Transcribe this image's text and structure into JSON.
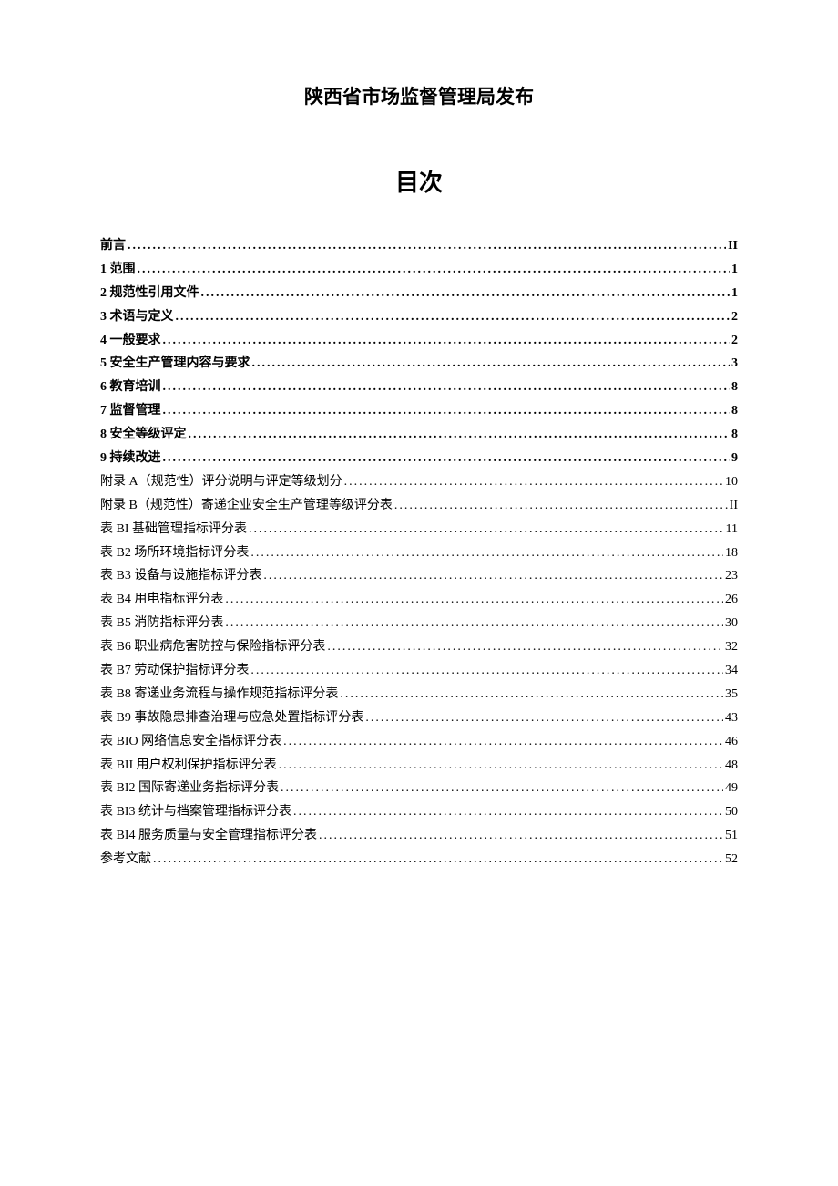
{
  "header": "陕西省市场监督管理局发布",
  "toc_title": "目次",
  "toc": [
    {
      "label": "前言",
      "page": "II",
      "bold": true
    },
    {
      "label": "1 范围",
      "page": "1",
      "bold": true
    },
    {
      "label": "2 规范性引用文件",
      "page": "1",
      "bold": true
    },
    {
      "label": "3 术语与定义",
      "page": "2",
      "bold": true
    },
    {
      "label": "4 一般要求",
      "page": "2",
      "bold": true
    },
    {
      "label": "5 安全生产管理内容与要求",
      "page": "3",
      "bold": true
    },
    {
      "label": "6 教育培训",
      "page": "8",
      "bold": true
    },
    {
      "label": "7 监督管理",
      "page": "8",
      "bold": true
    },
    {
      "label": "8 安全等级评定",
      "page": "8",
      "bold": true
    },
    {
      "label": "9 持续改进",
      "page": "9",
      "bold": true
    },
    {
      "label": "附录 A（规范性）评分说明与评定等级划分",
      "page": "10",
      "bold": false
    },
    {
      "label": "附录 B（规范性）寄递企业安全生产管理等级评分表",
      "page": "II",
      "bold": false
    },
    {
      "label": "表 BI 基础管理指标评分表",
      "page": "11",
      "bold": false
    },
    {
      "label": "表 B2 场所环境指标评分表",
      "page": "18",
      "bold": false
    },
    {
      "label": "表 B3 设备与设施指标评分表",
      "page": "23",
      "bold": false
    },
    {
      "label": "表 B4 用电指标评分表",
      "page": "26",
      "bold": false
    },
    {
      "label": "表 B5 消防指标评分表",
      "page": "30",
      "bold": false
    },
    {
      "label": "表 B6 职业病危害防控与保险指标评分表",
      "page": "32",
      "bold": false
    },
    {
      "label": "表 B7 劳动保护指标评分表",
      "page": "34",
      "bold": false
    },
    {
      "label": "表 B8 寄递业务流程与操作规范指标评分表",
      "page": "35",
      "bold": false
    },
    {
      "label": "表 B9 事故隐患排查治理与应急处置指标评分表",
      "page": "43",
      "bold": false
    },
    {
      "label": "表 BIO 网络信息安全指标评分表",
      "page": "46",
      "bold": false
    },
    {
      "label": "表 BII 用户权利保护指标评分表",
      "page": "48",
      "bold": false
    },
    {
      "label": "表 BI2 国际寄递业务指标评分表",
      "page": "49",
      "bold": false
    },
    {
      "label": "表 BI3 统计与档案管理指标评分表",
      "page": "50",
      "bold": false
    },
    {
      "label": "表 BI4 服务质量与安全管理指标评分表",
      "page": "51",
      "bold": false
    },
    {
      "label": "参考文献",
      "page": "52",
      "bold": false
    }
  ]
}
